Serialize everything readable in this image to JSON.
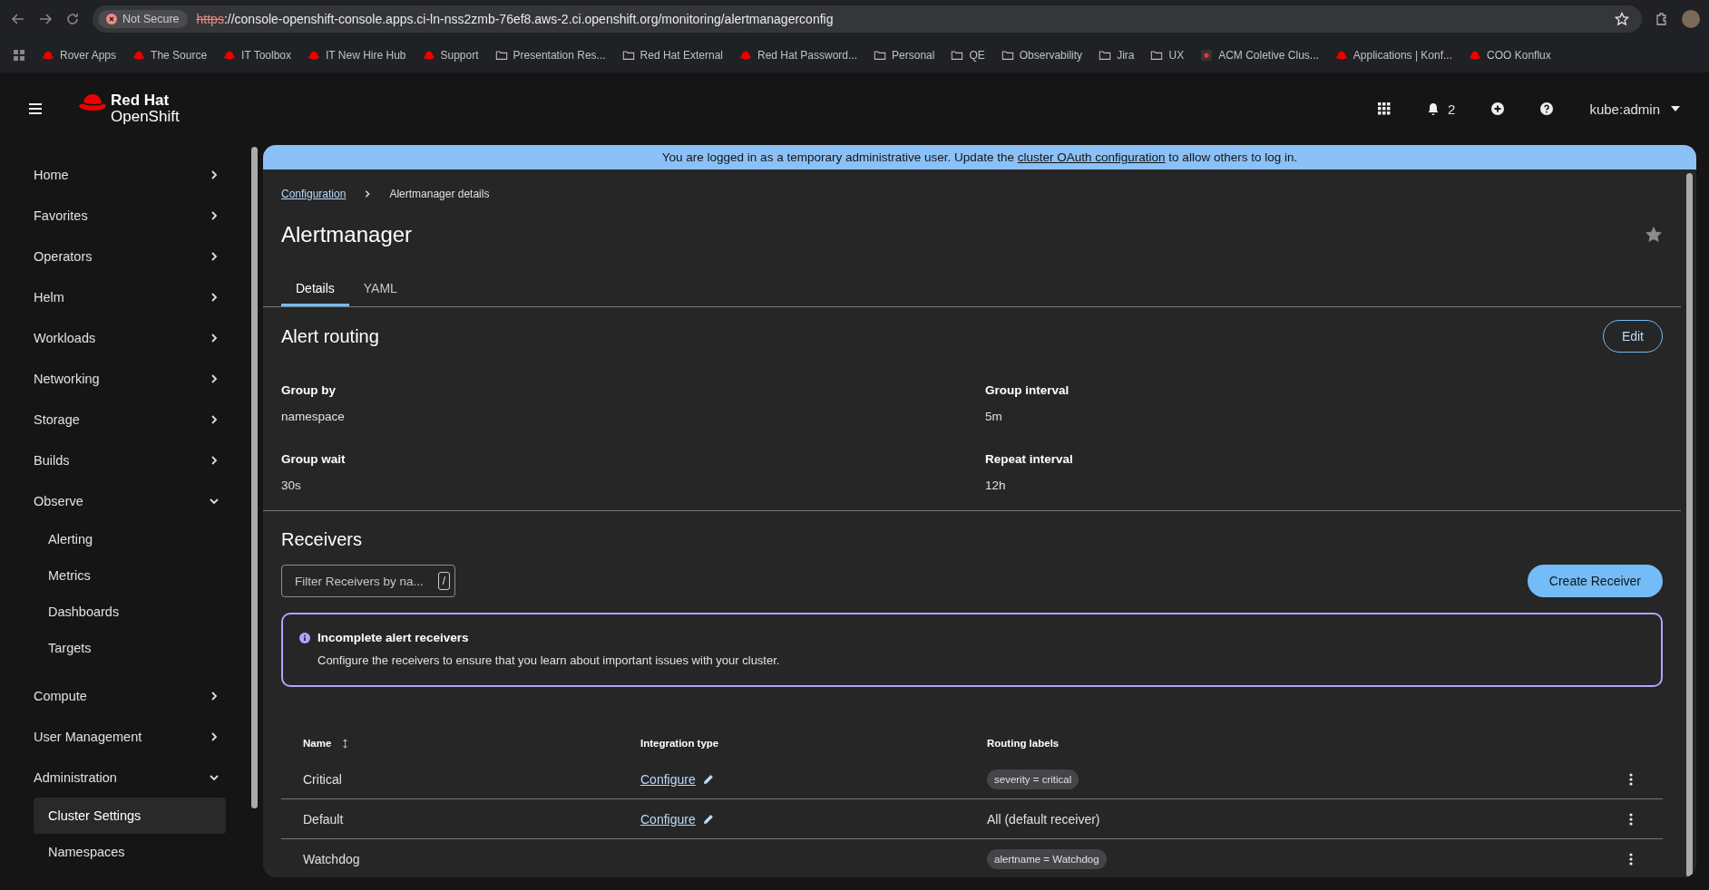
{
  "browser": {
    "security_label": "Not Secure",
    "url_scheme": "https",
    "url_rest": "://console-openshift-console.apps.ci-ln-nss2zmb-76ef8.aws-2.ci.openshift.org/monitoring/alertmanagerconfig",
    "bookmarks": [
      {
        "label": "Rover Apps",
        "kind": "hat"
      },
      {
        "label": "The Source",
        "kind": "hat"
      },
      {
        "label": "IT Toolbox",
        "kind": "hat"
      },
      {
        "label": "IT New Hire Hub",
        "kind": "hat"
      },
      {
        "label": "Support",
        "kind": "hat"
      },
      {
        "label": "Presentation Res...",
        "kind": "folder"
      },
      {
        "label": "Red Hat External",
        "kind": "folder"
      },
      {
        "label": "Red Hat Password...",
        "kind": "hat"
      },
      {
        "label": "Personal",
        "kind": "folder"
      },
      {
        "label": "QE",
        "kind": "folder"
      },
      {
        "label": "Observability",
        "kind": "folder"
      },
      {
        "label": "Jira",
        "kind": "folder"
      },
      {
        "label": "UX",
        "kind": "folder"
      },
      {
        "label": "ACM Coletive Clus...",
        "kind": "app"
      },
      {
        "label": "Applications | Konf...",
        "kind": "hat"
      },
      {
        "label": "COO Konflux",
        "kind": "hat"
      }
    ]
  },
  "masthead": {
    "brand_top": "Red Hat",
    "brand_bottom": "OpenShift",
    "notifications": "2",
    "user": "kube:admin"
  },
  "sidebar": {
    "items": [
      {
        "label": "Home",
        "expanded": false
      },
      {
        "label": "Favorites",
        "expanded": false
      },
      {
        "label": "Operators",
        "expanded": false
      },
      {
        "label": "Helm",
        "expanded": false
      },
      {
        "label": "Workloads",
        "expanded": false
      },
      {
        "label": "Networking",
        "expanded": false
      },
      {
        "label": "Storage",
        "expanded": false
      },
      {
        "label": "Builds",
        "expanded": false
      },
      {
        "label": "Observe",
        "expanded": true,
        "children": [
          {
            "label": "Alerting",
            "selected": false
          },
          {
            "label": "Metrics",
            "selected": false
          },
          {
            "label": "Dashboards",
            "selected": false
          },
          {
            "label": "Targets",
            "selected": false
          }
        ]
      },
      {
        "label": "Compute",
        "expanded": false
      },
      {
        "label": "User Management",
        "expanded": false
      },
      {
        "label": "Administration",
        "expanded": true,
        "children": [
          {
            "label": "Cluster Settings",
            "selected": true
          },
          {
            "label": "Namespaces",
            "selected": false
          }
        ]
      }
    ]
  },
  "banner": {
    "before": "You are logged in as a temporary administrative user. Update the",
    "link": "cluster OAuth configuration",
    "after": "to allow others to log in."
  },
  "breadcrumb": {
    "link": "Configuration",
    "current": "Alertmanager details"
  },
  "title": "Alertmanager",
  "tabs": [
    {
      "label": "Details",
      "selected": true
    },
    {
      "label": "YAML",
      "selected": false
    }
  ],
  "alert_routing": {
    "heading": "Alert routing",
    "edit": "Edit",
    "fields": [
      {
        "label": "Group by",
        "value": "namespace"
      },
      {
        "label": "Group interval",
        "value": "5m"
      },
      {
        "label": "Group wait",
        "value": "30s"
      },
      {
        "label": "Repeat interval",
        "value": "12h"
      }
    ]
  },
  "receivers": {
    "heading": "Receivers",
    "filter_placeholder": "Filter Receivers by na...",
    "filter_key": "/",
    "create": "Create Receiver",
    "alert": {
      "title": "Incomplete alert receivers",
      "body": "Configure the receivers to ensure that you learn about important issues with your cluster."
    },
    "table": {
      "columns": [
        "Name",
        "Integration type",
        "Routing labels"
      ],
      "rows": [
        {
          "name": "Critical",
          "integration": "Configure",
          "routing": "severity = critical",
          "kind": "label"
        },
        {
          "name": "Default",
          "integration": "Configure",
          "routing": "All (default receiver)",
          "kind": "text"
        },
        {
          "name": "Watchdog",
          "integration": "",
          "routing": "alertname = Watchdog",
          "kind": "label"
        }
      ]
    }
  }
}
